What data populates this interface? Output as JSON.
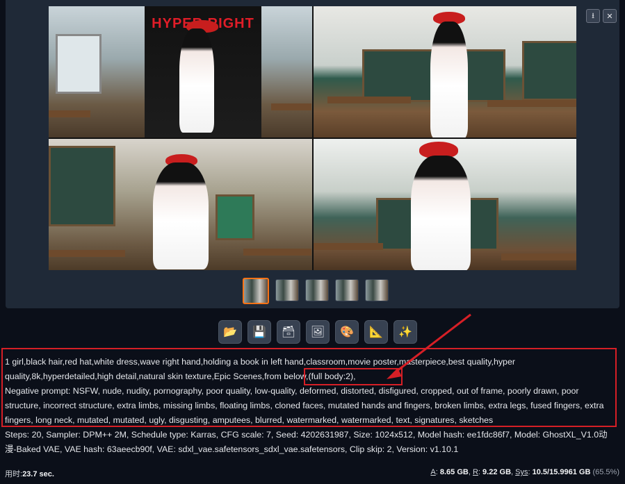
{
  "gallery": {
    "poster_text": "HYPER RIGHT",
    "top_buttons": [
      {
        "icon": "download-icon",
        "glyph": "⭳"
      },
      {
        "icon": "close-icon",
        "glyph": "✕"
      }
    ],
    "thumbnail_count": 5,
    "selected_thumbnail": 1
  },
  "actions": [
    {
      "icon": "folder-icon",
      "glyph": "📂"
    },
    {
      "icon": "save-icon",
      "glyph": "💾"
    },
    {
      "icon": "zip-icon",
      "glyph": "🗃"
    },
    {
      "icon": "image-icon",
      "glyph": "🖼"
    },
    {
      "icon": "palette-icon",
      "glyph": "🎨"
    },
    {
      "icon": "triangle-ruler-icon",
      "glyph": "📐"
    },
    {
      "icon": "sparkles-icon",
      "glyph": "✨"
    }
  ],
  "info": {
    "prompt": "1 girl,black hair,red hat,white dress,wave right hand,holding a book in left hand,classroom,movie poster,masterpiece,best quality,hyper quality,8k,hyperdetailed,high detail,natural skin texture,Epic Scenes,from below,(full body:2),",
    "negative": "Negative prompt: NSFW, nude, nudity, pornography, poor quality, low-quality, deformed, distorted, disfigured, cropped, out of frame, poorly drawn, poor structure, incorrect structure, extra limbs, missing limbs, floating limbs, cloned faces, mutated hands and fingers, broken limbs, extra legs, fused fingers, extra fingers, long neck, mutated, mutated, ugly, disgusting, amputees, blurred, watermarked, watermarked, text, signatures, sketches",
    "params": "Steps: 20, Sampler: DPM++ 2M, Schedule type: Karras, CFG scale: 7, Seed: 4202631987, Size: 1024x512, Model hash: ee1fdc86f7, Model: GhostXL_V1.0动漫-Baked VAE, VAE hash: 63aeecb90f, VAE: sdxl_vae.safetensors_sdxl_vae.safetensors, Clip skip: 2, Version: v1.10.1"
  },
  "footer": {
    "time_label": "用时:",
    "time_value": "23.7 sec.",
    "a_label": "A",
    "a_value": "8.65 GB",
    "r_label": "R",
    "r_value": "9.22 GB",
    "sys_label": "Sys",
    "sys_value": "10.5/15.9961 GB",
    "sys_pct": "(65.5%)"
  },
  "colors": {
    "background": "#0b0f19",
    "panel": "#1f2937",
    "accent": "#f97316",
    "annotation": "#d61f26"
  }
}
